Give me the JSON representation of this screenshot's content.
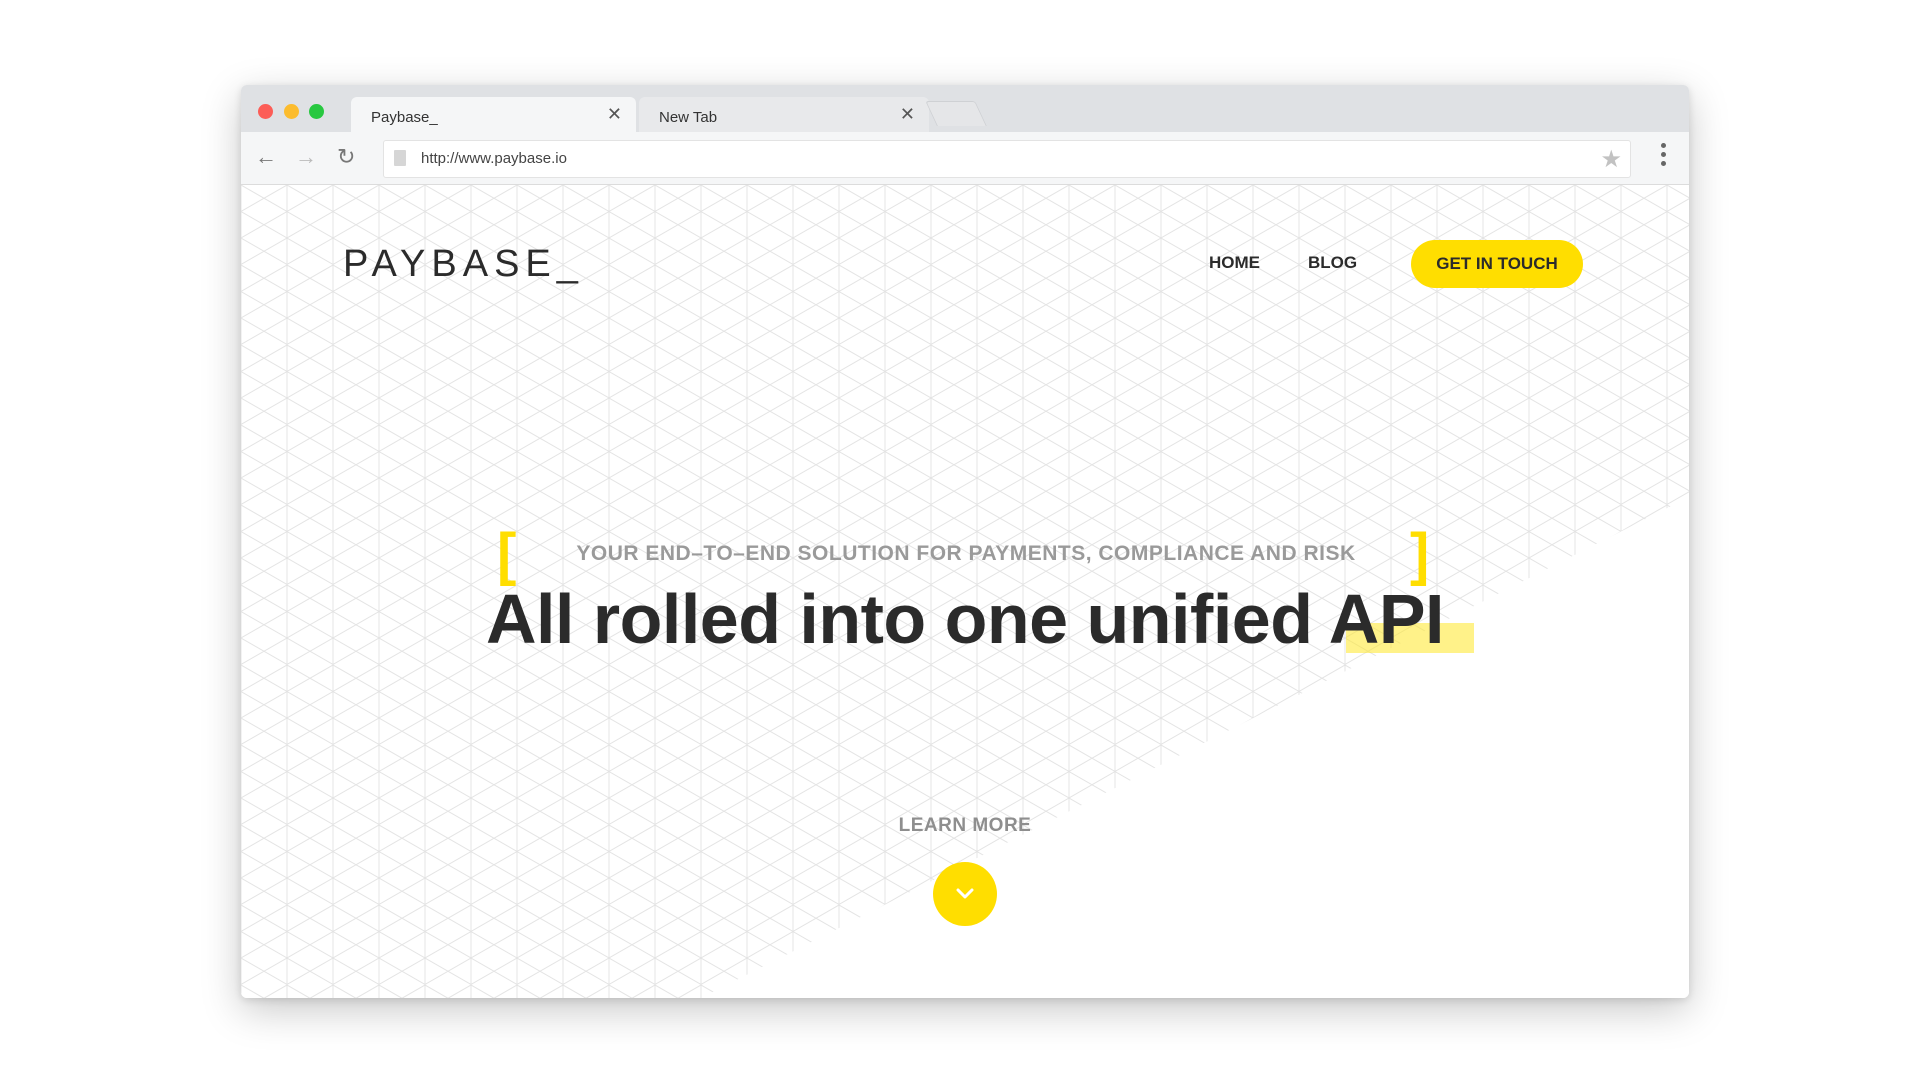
{
  "browser": {
    "tabs": [
      {
        "label": "Paybase_",
        "active": true
      },
      {
        "label": "New Tab",
        "active": false
      }
    ],
    "url": "http://www.paybase.io"
  },
  "site": {
    "logo": "PAYBASE_",
    "nav": {
      "home": "HOME",
      "blog": "BLOG",
      "cta": "GET IN TOUCH"
    },
    "hero": {
      "subtitle": "YOUR END–TO–END SOLUTION FOR PAYMENTS, COMPLIANCE AND RISK",
      "headline": "All rolled into one unified API",
      "learn_more": "LEARN MORE"
    }
  },
  "colors": {
    "accent": "#ffde00",
    "text": "#2b2b2b",
    "muted": "#9a9a9a"
  },
  "icons": {
    "down": "chevron-down-icon",
    "star": "star-icon",
    "reload": "reload-icon"
  }
}
